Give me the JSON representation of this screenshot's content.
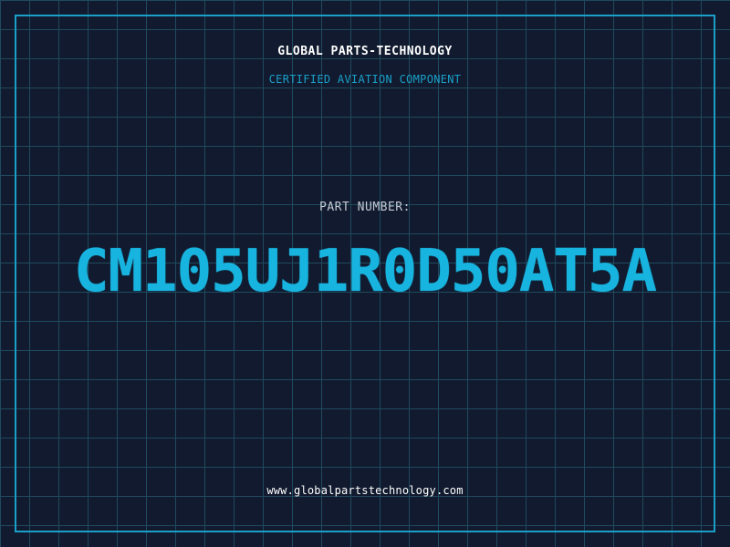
{
  "header": {
    "company_name": "GLOBAL PARTS-TECHNOLOGY",
    "subtitle": "CERTIFIED AVIATION COMPONENT"
  },
  "part": {
    "label": "PART NUMBER:",
    "number": "CM105UJ1R0D50AT5A"
  },
  "footer": {
    "website": "www.globalpartstechnology.com"
  },
  "colors": {
    "background": "#111a2e",
    "grid": "#1f4a5e",
    "accent": "#1aa0c8",
    "part_number": "#18b4e0",
    "text_primary": "#ffffff",
    "text_muted": "#c4cad3"
  }
}
